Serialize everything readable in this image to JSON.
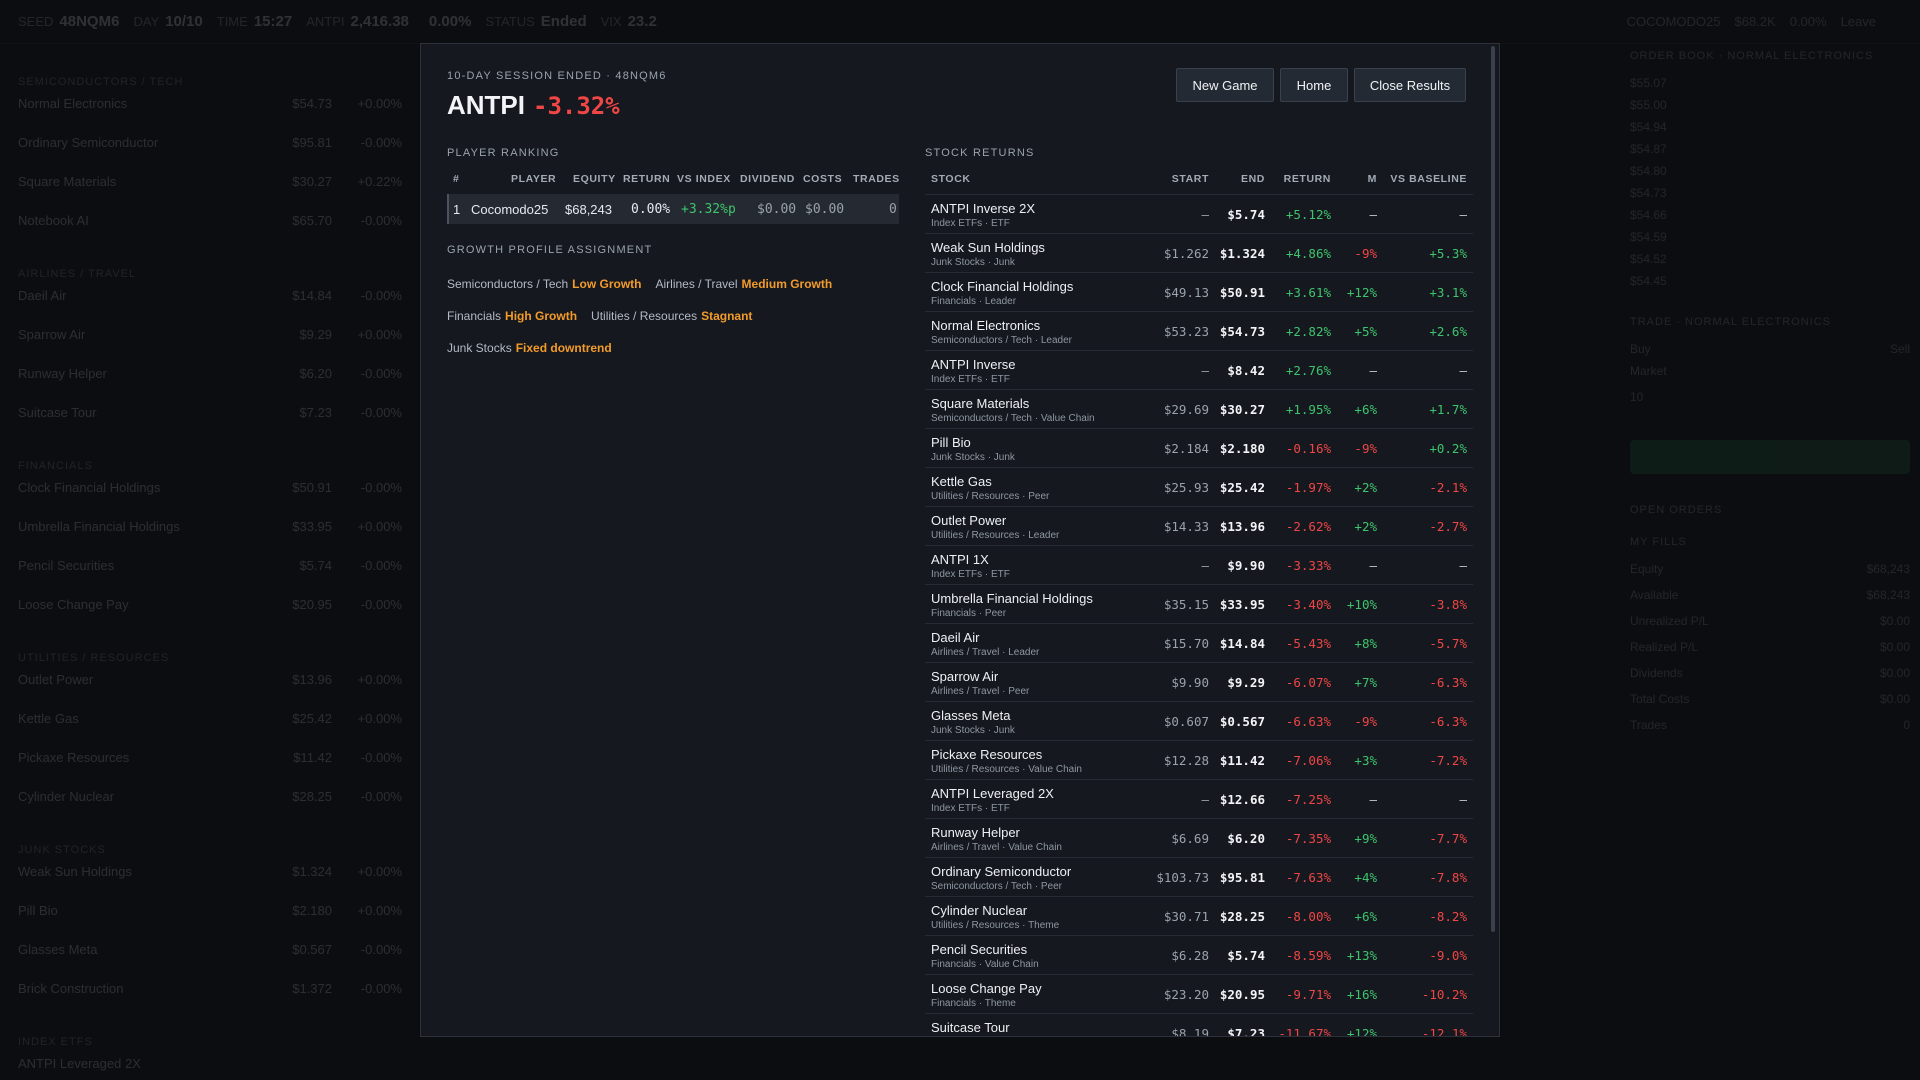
{
  "background": {
    "topbar": [
      {
        "label": "SEED",
        "value": "48NQM6"
      },
      {
        "label": "DAY",
        "value": "10/10"
      },
      {
        "label": "TIME",
        "value": "15:27"
      },
      {
        "label": "ANTPI",
        "value": "2,416.38"
      },
      {
        "label": "",
        "value": "0.00%"
      },
      {
        "label": "STATUS",
        "value": "Ended"
      },
      {
        "label": "VIX",
        "value": "23.2"
      }
    ],
    "topbar_right": {
      "label": "COCOMODO25",
      "equity": "$68.2K",
      "change": "0.00%",
      "leave": "Leave"
    },
    "left_groups": [
      {
        "header": "SEMICONDUCTORS / TECH",
        "rows": [
          {
            "name": "Normal Electronics",
            "price": "$54.73",
            "change": "+0.00%"
          },
          {
            "name": "Ordinary Semiconductor",
            "price": "$95.81",
            "change": "-0.00%"
          },
          {
            "name": "Square Materials",
            "price": "$30.27",
            "change": "+0.22%"
          },
          {
            "name": "Notebook AI",
            "price": "$65.70",
            "change": "-0.00%"
          }
        ]
      },
      {
        "header": "AIRLINES / TRAVEL",
        "rows": [
          {
            "name": "Daeil Air",
            "price": "$14.84",
            "change": "-0.00%"
          },
          {
            "name": "Sparrow Air",
            "price": "$9.29",
            "change": "+0.00%"
          },
          {
            "name": "Runway Helper",
            "price": "$6.20",
            "change": "-0.00%"
          },
          {
            "name": "Suitcase Tour",
            "price": "$7.23",
            "change": "-0.00%"
          }
        ]
      },
      {
        "header": "FINANCIALS",
        "rows": [
          {
            "name": "Clock Financial Holdings",
            "price": "$50.91",
            "change": "-0.00%"
          },
          {
            "name": "Umbrella Financial Holdings",
            "price": "$33.95",
            "change": "+0.00%"
          },
          {
            "name": "Pencil Securities",
            "price": "$5.74",
            "change": "-0.00%"
          },
          {
            "name": "Loose Change Pay",
            "price": "$20.95",
            "change": "-0.00%"
          }
        ]
      },
      {
        "header": "UTILITIES / RESOURCES",
        "rows": [
          {
            "name": "Outlet Power",
            "price": "$13.96",
            "change": "+0.00%"
          },
          {
            "name": "Kettle Gas",
            "price": "$25.42",
            "change": "+0.00%"
          },
          {
            "name": "Pickaxe Resources",
            "price": "$11.42",
            "change": "-0.00%"
          },
          {
            "name": "Cylinder Nuclear",
            "price": "$28.25",
            "change": "-0.00%"
          }
        ]
      },
      {
        "header": "JUNK STOCKS",
        "rows": [
          {
            "name": "Weak Sun Holdings",
            "price": "$1.324",
            "change": "+0.00%"
          },
          {
            "name": "Pill Bio",
            "price": "$2.180",
            "change": "+0.00%"
          },
          {
            "name": "Glasses Meta",
            "price": "$0.567",
            "change": "-0.00%"
          },
          {
            "name": "Brick Construction",
            "price": "$1.372",
            "change": "-0.00%"
          }
        ]
      },
      {
        "header": "INDEX ETFS",
        "rows": [
          {
            "name": "ANTPI Leveraged 2X",
            "price": "",
            "change": ""
          }
        ]
      }
    ],
    "right_panel": {
      "orderbook_title": "ORDER BOOK · NORMAL ELECTRONICS",
      "orderbook": [
        "$55.07",
        "$55.00",
        "$54.94",
        "$54.87",
        "$54.80",
        "$54.73",
        "$54.66",
        "$54.59",
        "$54.52",
        "$54.45"
      ],
      "trade_title": "TRADE · NORMAL ELECTRONICS",
      "buy": "Buy",
      "sell": "Sell",
      "order_type": "Market",
      "quantity": "10",
      "trade_btn": "Trade",
      "open_orders": "OPEN ORDERS",
      "my_fills": "MY FILLS",
      "stats": [
        {
          "k": "Equity",
          "v": "$68,243"
        },
        {
          "k": "Available",
          "v": "$68,243"
        },
        {
          "k": "Unrealized P/L",
          "v": "$0.00"
        },
        {
          "k": "Realized P/L",
          "v": "$0.00"
        },
        {
          "k": "Dividends",
          "v": "$0.00"
        },
        {
          "k": "Total Costs",
          "v": "$0.00"
        },
        {
          "k": "Trades",
          "v": "0"
        }
      ]
    }
  },
  "modal": {
    "subtitle": "10-DAY SESSION ENDED · 48NQM6",
    "index_name": "ANTPI",
    "index_return": "-3.32%",
    "buttons": {
      "new_game": "New Game",
      "home": "Home",
      "close": "Close Results"
    },
    "ranking": {
      "title": "PLAYER RANKING",
      "headers": {
        "rank": "#",
        "player": "PLAYER",
        "equity": "EQUITY",
        "ret": "RETURN",
        "vs_index": "VS INDEX",
        "dividend": "DIVIDEND",
        "costs": "COSTS",
        "trades": "TRADES"
      },
      "rows": [
        {
          "rank": "1",
          "player": "Cocomodo25",
          "equity": "$68,243",
          "ret": "0.00%",
          "vs_index": "+3.32%p",
          "dividend": "$0.00",
          "costs": "$0.00",
          "trades": "0"
        }
      ]
    },
    "growth": {
      "title": "GROWTH PROFILE ASSIGNMENT",
      "items": [
        {
          "sector": "Semiconductors / Tech",
          "profile": "Low Growth"
        },
        {
          "sector": "Airlines / Travel",
          "profile": "Medium Growth"
        },
        {
          "sector": "Financials",
          "profile": "High Growth"
        },
        {
          "sector": "Utilities / Resources",
          "profile": "Stagnant"
        },
        {
          "sector": "Junk Stocks",
          "profile": "Fixed downtrend"
        }
      ]
    },
    "returns": {
      "title": "STOCK RETURNS",
      "headers": {
        "stock": "STOCK",
        "start": "START",
        "end": "END",
        "ret": "RETURN",
        "m": "M",
        "vs": "VS BASELINE"
      },
      "rows": [
        {
          "name": "ANTPI Inverse 2X",
          "sub": "Index ETFs · ETF",
          "start": "–",
          "end": "$5.74",
          "ret": "+5.12%",
          "m": "–",
          "vs": "–"
        },
        {
          "name": "Weak Sun Holdings",
          "sub": "Junk Stocks · Junk",
          "start": "$1.262",
          "end": "$1.324",
          "ret": "+4.86%",
          "m": "-9%",
          "vs": "+5.3%"
        },
        {
          "name": "Clock Financial Holdings",
          "sub": "Financials · Leader",
          "start": "$49.13",
          "end": "$50.91",
          "ret": "+3.61%",
          "m": "+12%",
          "vs": "+3.1%"
        },
        {
          "name": "Normal Electronics",
          "sub": "Semiconductors / Tech · Leader",
          "start": "$53.23",
          "end": "$54.73",
          "ret": "+2.82%",
          "m": "+5%",
          "vs": "+2.6%"
        },
        {
          "name": "ANTPI Inverse",
          "sub": "Index ETFs · ETF",
          "start": "–",
          "end": "$8.42",
          "ret": "+2.76%",
          "m": "–",
          "vs": "–"
        },
        {
          "name": "Square Materials",
          "sub": "Semiconductors / Tech · Value Chain",
          "start": "$29.69",
          "end": "$30.27",
          "ret": "+1.95%",
          "m": "+6%",
          "vs": "+1.7%"
        },
        {
          "name": "Pill Bio",
          "sub": "Junk Stocks · Junk",
          "start": "$2.184",
          "end": "$2.180",
          "ret": "-0.16%",
          "m": "-9%",
          "vs": "+0.2%"
        },
        {
          "name": "Kettle Gas",
          "sub": "Utilities / Resources · Peer",
          "start": "$25.93",
          "end": "$25.42",
          "ret": "-1.97%",
          "m": "+2%",
          "vs": "-2.1%"
        },
        {
          "name": "Outlet Power",
          "sub": "Utilities / Resources · Leader",
          "start": "$14.33",
          "end": "$13.96",
          "ret": "-2.62%",
          "m": "+2%",
          "vs": "-2.7%"
        },
        {
          "name": "ANTPI 1X",
          "sub": "Index ETFs · ETF",
          "start": "–",
          "end": "$9.90",
          "ret": "-3.33%",
          "m": "–",
          "vs": "–"
        },
        {
          "name": "Umbrella Financial Holdings",
          "sub": "Financials · Peer",
          "start": "$35.15",
          "end": "$33.95",
          "ret": "-3.40%",
          "m": "+10%",
          "vs": "-3.8%"
        },
        {
          "name": "Daeil Air",
          "sub": "Airlines / Travel · Leader",
          "start": "$15.70",
          "end": "$14.84",
          "ret": "-5.43%",
          "m": "+8%",
          "vs": "-5.7%"
        },
        {
          "name": "Sparrow Air",
          "sub": "Airlines / Travel · Peer",
          "start": "$9.90",
          "end": "$9.29",
          "ret": "-6.07%",
          "m": "+7%",
          "vs": "-6.3%"
        },
        {
          "name": "Glasses Meta",
          "sub": "Junk Stocks · Junk",
          "start": "$0.607",
          "end": "$0.567",
          "ret": "-6.63%",
          "m": "-9%",
          "vs": "-6.3%"
        },
        {
          "name": "Pickaxe Resources",
          "sub": "Utilities / Resources · Value Chain",
          "start": "$12.28",
          "end": "$11.42",
          "ret": "-7.06%",
          "m": "+3%",
          "vs": "-7.2%"
        },
        {
          "name": "ANTPI Leveraged 2X",
          "sub": "Index ETFs · ETF",
          "start": "–",
          "end": "$12.66",
          "ret": "-7.25%",
          "m": "–",
          "vs": "–"
        },
        {
          "name": "Runway Helper",
          "sub": "Airlines / Travel · Value Chain",
          "start": "$6.69",
          "end": "$6.20",
          "ret": "-7.35%",
          "m": "+9%",
          "vs": "-7.7%"
        },
        {
          "name": "Ordinary Semiconductor",
          "sub": "Semiconductors / Tech · Peer",
          "start": "$103.73",
          "end": "$95.81",
          "ret": "-7.63%",
          "m": "+4%",
          "vs": "-7.8%"
        },
        {
          "name": "Cylinder Nuclear",
          "sub": "Utilities / Resources · Theme",
          "start": "$30.71",
          "end": "$28.25",
          "ret": "-8.00%",
          "m": "+6%",
          "vs": "-8.2%"
        },
        {
          "name": "Pencil Securities",
          "sub": "Financials · Value Chain",
          "start": "$6.28",
          "end": "$5.74",
          "ret": "-8.59%",
          "m": "+13%",
          "vs": "-9.0%"
        },
        {
          "name": "Loose Change Pay",
          "sub": "Financials · Theme",
          "start": "$23.20",
          "end": "$20.95",
          "ret": "-9.71%",
          "m": "+16%",
          "vs": "-10.2%"
        },
        {
          "name": "Suitcase Tour",
          "sub": "Airlines / Travel · Peer",
          "start": "$8.19",
          "end": "$7.23",
          "ret": "-11.67%",
          "m": "+12%",
          "vs": "-12.1%"
        }
      ]
    }
  },
  "colors": {
    "positive": "#3ec46d",
    "negative": "#ef4646",
    "accent": "#f29b2b",
    "modal_bg": "#15181e",
    "page_bg": "#0b0d11"
  }
}
